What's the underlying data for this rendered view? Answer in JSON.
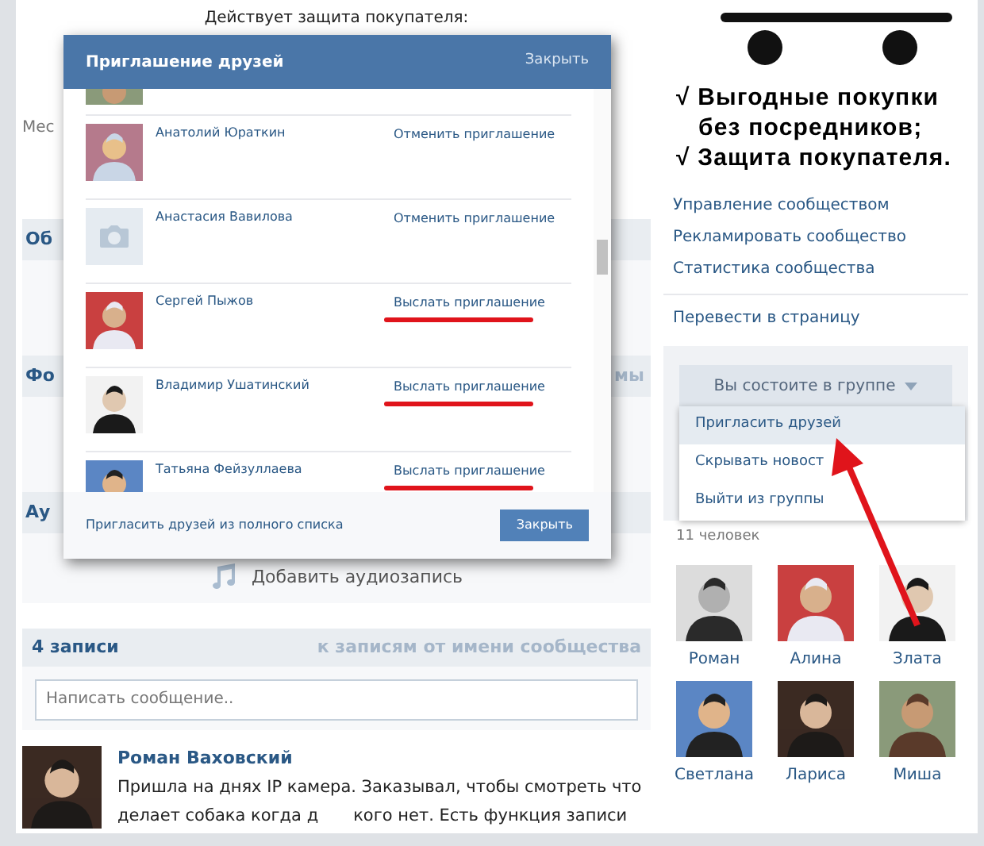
{
  "wall": {
    "notice": "Действует защита покупателя:",
    "place_label": "Мес",
    "sections": [
      {
        "title": "Об"
      },
      {
        "title": "Фо",
        "link": "мы"
      },
      {
        "title": "Ау"
      }
    ]
  },
  "audio": {
    "add_label": "Добавить аудиозапись"
  },
  "posts_header": {
    "count": "4 записи",
    "link": "к записям от имени сообщества"
  },
  "composer": {
    "placeholder": "Написать сообщение.."
  },
  "post": {
    "author": "Роман Ваховский",
    "line_1": "Пришла на днях IP камера. Заказывал, чтобы смотреть что",
    "line_2_start": "делает собака когда д",
    "line_2_end": "кого нет. Есть функция записи"
  },
  "promo": {
    "lines": [
      "√ Выгодные покупки",
      "без посредников;",
      "√ Защита покупателя."
    ]
  },
  "admin_links": [
    "Управление сообществом",
    "Рекламировать сообщество",
    "Статистика сообщества"
  ],
  "convert_link": "Перевести в страницу",
  "membership": {
    "button": "Вы состоите в группе",
    "expanded": true,
    "menu": [
      {
        "label": "Пригласить друзей",
        "selected": true
      },
      {
        "label": "Скрывать новост",
        "selected": false
      },
      {
        "label": "Выйти из группы",
        "selected": false
      }
    ]
  },
  "members": {
    "count": "11 человек",
    "items": [
      {
        "name": "Роман"
      },
      {
        "name": "Алина"
      },
      {
        "name": "Злата"
      },
      {
        "name": "Светлана"
      },
      {
        "name": "Лариса"
      },
      {
        "name": "Миша"
      }
    ]
  },
  "dialog": {
    "title": "Приглашение друзей",
    "close_link": "Закрыть",
    "rows": [
      {
        "name": "Анатолий Юраткин",
        "action": "Отменить приглашение",
        "underlined": false
      },
      {
        "kind": "no_photo",
        "name": "Анастасия Вавилова",
        "action": "Отменить приглашение",
        "underlined": false
      },
      {
        "name": "Сергей Пыжов",
        "action": "Выслать приглашение",
        "underlined": true
      },
      {
        "name": "Владимир Ушатинский",
        "action": "Выслать приглашение",
        "underlined": true
      },
      {
        "name": "Татьяна Фейзуллаева",
        "action": "Выслать приглашение",
        "underlined": true
      }
    ],
    "footer_link": "Пригласить друзей из полного списка",
    "button": "Закрыть"
  }
}
